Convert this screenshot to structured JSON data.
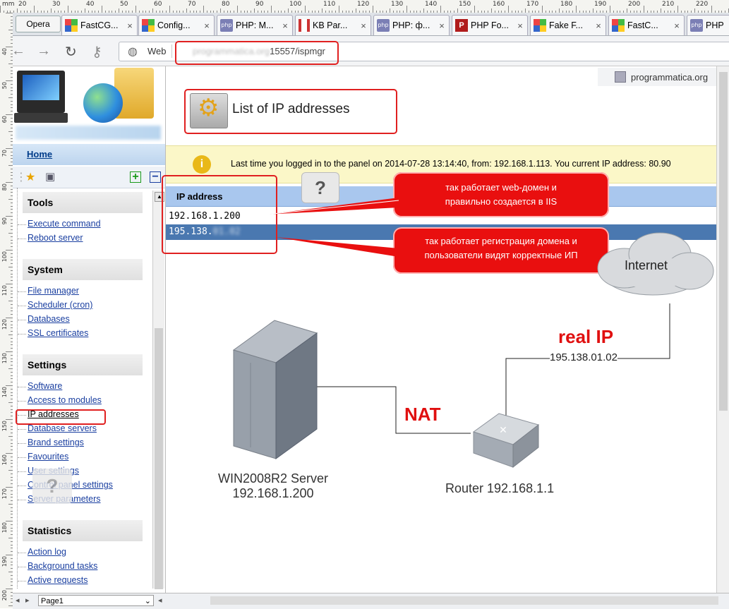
{
  "ruler": {
    "unit": "mm",
    "top_numbers": [
      "20",
      "30",
      "40",
      "50",
      "60",
      "70",
      "80",
      "90",
      "100",
      "110",
      "120",
      "130",
      "140",
      "150",
      "160",
      "170",
      "180",
      "190",
      "200",
      "210",
      "220"
    ],
    "left_numbers": [
      "40",
      "50",
      "60",
      "70",
      "80",
      "90",
      "100",
      "110",
      "120",
      "130",
      "140",
      "150",
      "160",
      "170",
      "180",
      "190",
      "200"
    ]
  },
  "tabs": {
    "opera_label": "Opera",
    "items": [
      {
        "label": "FastCG...",
        "icon": "windows-icon"
      },
      {
        "label": "Config...",
        "icon": "windows-icon"
      },
      {
        "label": "PHP: M...",
        "icon": "php-icon"
      },
      {
        "label": "KB Par...",
        "icon": "kb-icon"
      },
      {
        "label": "PHP: ф...",
        "icon": "php-icon"
      },
      {
        "label": "PHP Fo...",
        "icon": "phpfog-icon"
      },
      {
        "label": "Fake F...",
        "icon": "windows-icon"
      },
      {
        "label": "FastC...",
        "icon": "windows-icon"
      },
      {
        "label": "PHP",
        "icon": "php-icon"
      }
    ],
    "close_glyph": "×",
    "php_badge": "php"
  },
  "nav": {
    "back": "←",
    "forward": "→",
    "reload": "↻",
    "key": "⚷"
  },
  "address": {
    "web_label": "Web",
    "url_blurred": "programmatica.org",
    "url_visible": "15557/ispmgr"
  },
  "bookmark": {
    "label": "programmatica.org"
  },
  "sidebar": {
    "home": "Home",
    "sections": [
      {
        "title": "Tools",
        "items": [
          "Execute command",
          "Reboot server"
        ]
      },
      {
        "title": "System",
        "items": [
          "File manager",
          "Scheduler (cron)",
          "Databases",
          "SSL certificates"
        ]
      },
      {
        "title": "Settings",
        "items": [
          "Software",
          "Access to modules",
          "IP addresses",
          "Database servers",
          "Brand settings",
          "Favourites",
          "User settings",
          "Control panel settings",
          "Server parameters"
        ]
      },
      {
        "title": "Statistics",
        "items": [
          "Action log",
          "Background tasks",
          "Active requests"
        ]
      }
    ],
    "icons": {
      "star": "★",
      "plus": "+",
      "minus": "−",
      "help": "?"
    }
  },
  "page": {
    "title": "List of IP addresses",
    "notice": "Last time you logged in to the panel on 2014-07-28 13:14:40, from: 192.168.1.113. You current IP address: 80.90",
    "info_glyph": "i",
    "help_glyph": "?",
    "table": {
      "header": "IP address",
      "rows": [
        {
          "ip": "192.168.1.200",
          "selected": false
        },
        {
          "ip": "195.138.",
          "ip_blurred": "01.02",
          "selected": true
        }
      ]
    }
  },
  "callouts": [
    {
      "text_line1": "так работает web-домен и",
      "text_line2": "правильно создается в IIS"
    },
    {
      "text_line1": "так работает регистрация домена и",
      "text_line2": "пользователи видят корректные ИП"
    }
  ],
  "diagram": {
    "internet_label": "Internet",
    "real_ip_label": "real IP",
    "real_ip_value": "195.138.01.02",
    "nat_label": "NAT",
    "server_line1": "WIN2008R2 Server",
    "server_line2": "192.168.1.200",
    "router_label": "Router 192.168.1.1"
  },
  "bottom": {
    "page_select": "Page1",
    "arrows": [
      "◂",
      "▸"
    ]
  },
  "colors": {
    "accent_red": "#e90f0f",
    "header_blue": "#a9c7ee",
    "selected_row": "#4a78b0",
    "notice_yellow": "#fbf7c8",
    "link_blue": "#1a3fa0"
  }
}
